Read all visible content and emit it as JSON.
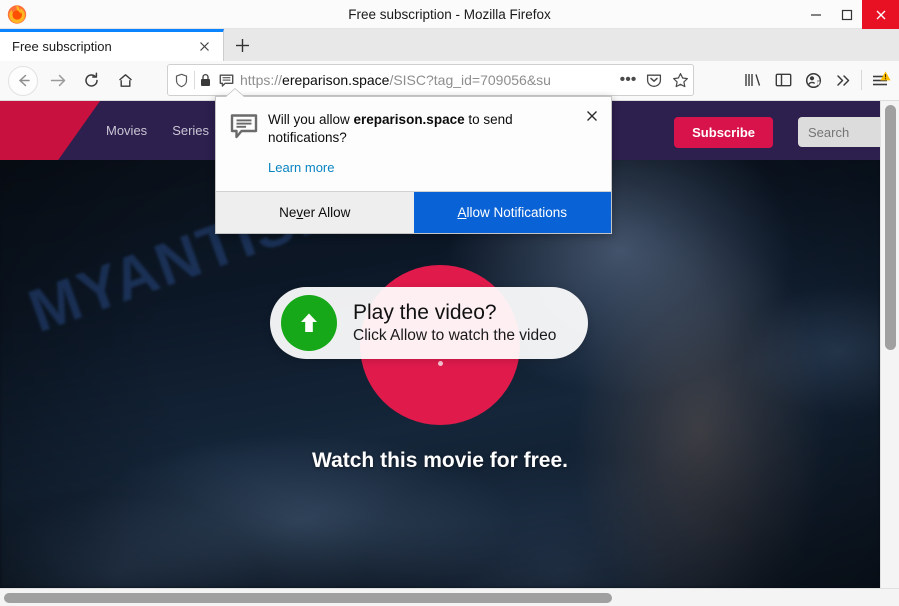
{
  "window": {
    "title": "Free subscription - Mozilla Firefox",
    "minimize_label": "—",
    "maximize_label": "☐",
    "close_label": "✕"
  },
  "tabs": {
    "active": {
      "title": "Free subscription",
      "close_label": "✕"
    },
    "new_tab_label": "+"
  },
  "toolbar": {
    "back_label": "←",
    "forward_label": "→",
    "reload_label": "↻",
    "home_label": "⌂",
    "url": {
      "scheme": "https://",
      "host": "ereparison.space",
      "path": "/SISC?tag_id=709056&su",
      "full": "https://ereparison.space/SISC?tag_id=709056&su"
    },
    "page_actions_label": "•••",
    "icons": {
      "shield": "shield-icon",
      "lock": "lock-icon",
      "notification_permission": "notification-bubble-icon",
      "pocket": "pocket-icon",
      "bookmark": "star-icon",
      "library": "library-icon",
      "sidebar": "sidebar-icon",
      "account": "account-sync-icon",
      "overflow": "chevron-double-right-icon",
      "menu": "hamburger-menu-icon"
    }
  },
  "permission_popup": {
    "question_prefix": "Will you allow ",
    "question_domain": "ereparison.space",
    "question_suffix": " to send notifications?",
    "learn_more": "Learn more",
    "close_label": "✕",
    "never_allow": {
      "pre": "Ne",
      "key": "v",
      "post": "er Allow"
    },
    "allow": {
      "pre": "",
      "key": "A",
      "post": "llow Notifications"
    },
    "primary_color": "#0a63d6"
  },
  "site": {
    "header": {
      "nav": [
        {
          "label": "Movies"
        },
        {
          "label": "Series"
        }
      ],
      "subscribe_label": "Subscribe",
      "search_placeholder": "Search",
      "brand_color": "#c9113f",
      "header_bg": "#2d1f4e"
    },
    "hero": {
      "play_title": "Play the video?",
      "play_subtitle": "Click Allow to watch the video",
      "arrow_icon": "upload-arrow-icon",
      "circle_color": "#e01b4c",
      "play_button_color": "#16a818",
      "caption": "Watch this movie for free."
    },
    "watermark": "MYANTISPYWARE.COM"
  },
  "scrollbars": {
    "vertical_name": "vertical-scrollbar",
    "horizontal_name": "horizontal-scrollbar"
  }
}
